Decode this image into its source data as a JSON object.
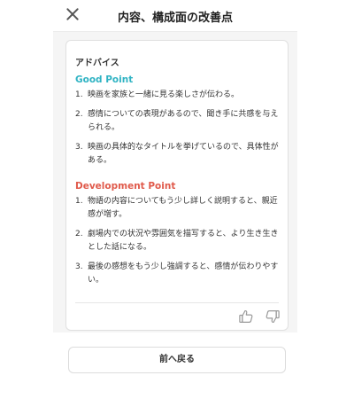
{
  "header": {
    "title": "内容、構成面の改善点"
  },
  "card": {
    "title": "アドバイス",
    "good_heading": "Good Point",
    "good_items": [
      {
        "num": "1.",
        "text": "映画を家族と一緒に見る楽しさが伝わる。"
      },
      {
        "num": "2.",
        "text": "感情についての表現があるので、聞き手に共感を与えられる。"
      },
      {
        "num": "3.",
        "text": "映画の具体的なタイトルを挙げているので、具体性がある。"
      }
    ],
    "dev_heading": "Development Point",
    "dev_items": [
      {
        "num": "1.",
        "text": "物語の内容についてもう少し詳しく説明すると、親近感が増す。"
      },
      {
        "num": "2.",
        "text": "劇場内での状況や雰囲気を描写すると、より生き生きとした話になる。"
      },
      {
        "num": "3.",
        "text": "最後の感想をもう少し強調すると、感情が伝わりやすい。"
      }
    ]
  },
  "footer": {
    "back_label": "前へ戻る"
  },
  "colors": {
    "good": "#2fb3c3",
    "development": "#e05a4b",
    "icon": "#9a9a9a"
  }
}
